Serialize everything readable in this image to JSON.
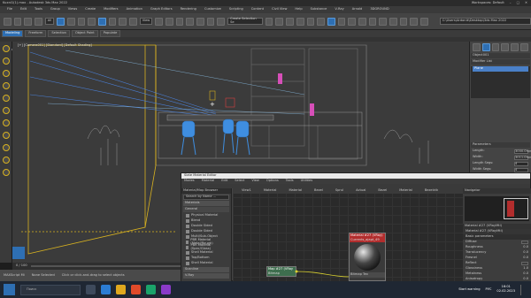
{
  "app": {
    "title": "Kuxni1(1).max - Autodesk 3ds Max 2022",
    "workspace": "Workspaces: Default",
    "project_path": "C:\\Users\\Ardonik\\Desktop\\3ds Max 2022"
  },
  "menu": [
    "File",
    "Edit",
    "Tools",
    "Group",
    "Views",
    "Create",
    "Modifiers",
    "Animation",
    "Graph Editors",
    "Rendering",
    "Customize",
    "Scripting",
    "Content",
    "Civil View",
    "Help",
    "Substance",
    "V-Ray",
    "Arnold",
    "3DGROUND"
  ],
  "toolbar": {
    "selection_filter": "All",
    "view_dropdown": "View",
    "selection_set": "Create Selection Se"
  },
  "ribbon": {
    "tabs": [
      "Modeling",
      "Freeform",
      "Selection",
      "Object Paint",
      "Populate"
    ],
    "active_tab": "Modeling",
    "sub_label": "Polygon Modeling"
  },
  "viewport": {
    "label": "[+] [Camera001] [Standard] [Default Shading]"
  },
  "command_panel": {
    "object_name": "Object001",
    "modifier_list": "Modifier List",
    "stack_item": "Plane",
    "parameters_title": "Parameters",
    "params": [
      {
        "label": "Length:",
        "value": "3000.0mm"
      },
      {
        "label": "Width:",
        "value": "3011.0mm"
      },
      {
        "label": "Length Segs:",
        "value": "4"
      },
      {
        "label": "Width Segs:",
        "value": "4"
      },
      {
        "label": "Render Multipliers",
        "value": ""
      },
      {
        "label": "Scale:",
        "value": "1.0"
      },
      {
        "label": "Density:",
        "value": "1.0"
      }
    ]
  },
  "timeline": {
    "frame": "0 / 100"
  },
  "status": {
    "selected": "None Selected",
    "prompt": "Click or click-and-drag to select objects",
    "maxscript": "MAXScript Mi"
  },
  "slate": {
    "title": "Slate Material Editor",
    "menu": [
      "Modes",
      "Material",
      "Edit",
      "Select",
      "View",
      "Options",
      "Tools",
      "Utilities"
    ],
    "graph_tabs": [
      "View1",
      "Material",
      "Material",
      "Bezel",
      "Sprul",
      "Actual",
      "Bezel",
      "Material",
      "Bezelctk"
    ],
    "browser_title": "Material/Map Browser",
    "search_placeholder": "Search by Name ...",
    "group_materials": "Materials",
    "group_general": "General",
    "general_items": [
      "Physical Material",
      "Blend",
      "Double Sided",
      "Double Sided",
      "Multi/Sub-Object",
      "PBR Material (Metal/Rough)",
      "PBR Material (Spec/Gloss)",
      "Shell Material",
      "Top/Bottom",
      "Shell Material"
    ],
    "group_scanline": "Scanline",
    "group_vray": "V-Ray",
    "group_controls": "Controls",
    "node_material_title": "Material #27 (VRay)",
    "node_material_sub": "Currents_ajapt_49",
    "node_map_title": "Map #27 (VRay",
    "node_map_sub": "Bitmap",
    "node_bottom": "Bitmap Tex",
    "navigator": "Navigator",
    "params_title": "Material #27 (VRayMtl)",
    "params_sub": "Material #27 (VRayMtl)",
    "basic_params": "Basic parameters",
    "params": [
      {
        "label": "Diffuse",
        "value": ""
      },
      {
        "label": "Roughness",
        "value": "0.0"
      },
      {
        "label": "Translucency",
        "value": "0.0"
      },
      {
        "label": "Fresnel",
        "value": "0.0"
      },
      {
        "label": "Reflect",
        "value": ""
      },
      {
        "label": "Glossiness",
        "value": "1.0"
      },
      {
        "label": "Metalness",
        "value": "0.0"
      },
      {
        "label": "Anisotropy",
        "value": "0.0"
      }
    ],
    "zoom": "100%"
  },
  "taskbar": {
    "search_placeholder": "Поиск",
    "notification": "Start warning",
    "time": "16:01",
    "date": "02.02.2023",
    "lang": "РУС"
  },
  "colors": {
    "accent": "#2e6fb3",
    "selection_yellow": "#d8b220",
    "chairs": "#3f8ee0"
  }
}
